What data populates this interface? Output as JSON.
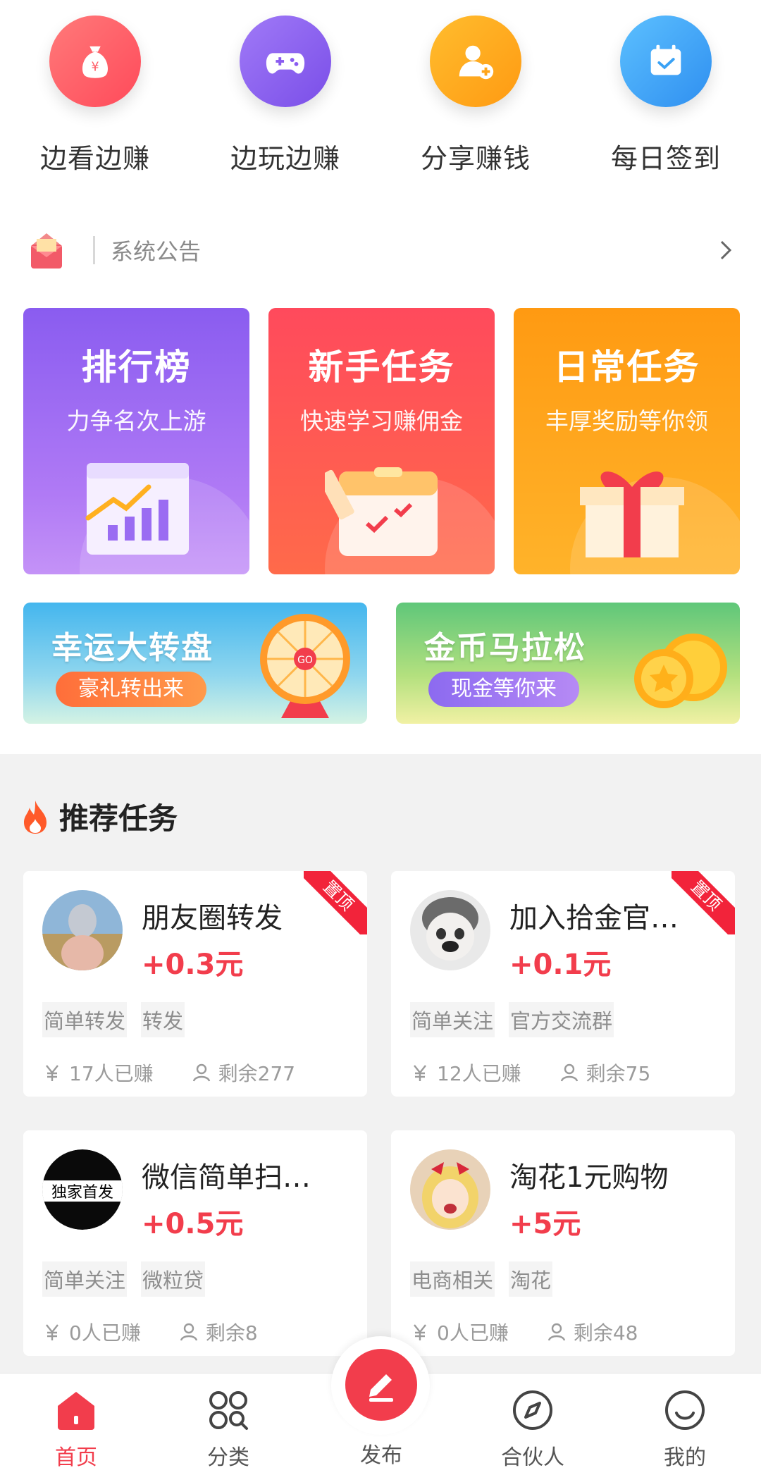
{
  "quick_entries": [
    {
      "label": "边看边赚",
      "icon": "money-bag-icon",
      "color": "#ff5a64"
    },
    {
      "label": "边玩边赚",
      "icon": "gamepad-icon",
      "color": "#8a5cf0"
    },
    {
      "label": "分享赚钱",
      "icon": "add-user-icon",
      "color": "#ffa51a"
    },
    {
      "label": "每日签到",
      "icon": "calendar-check-icon",
      "color": "#3aa2f5"
    }
  ],
  "notice": {
    "text": "系统公告"
  },
  "feature_cards": [
    {
      "title": "排行榜",
      "subtitle": "力争名次上游"
    },
    {
      "title": "新手任务",
      "subtitle": "快速学习赚佣金"
    },
    {
      "title": "日常任务",
      "subtitle": "丰厚奖励等你领"
    }
  ],
  "banners": [
    {
      "title": "幸运大转盘",
      "button": "豪礼转出来"
    },
    {
      "title": "金币马拉松",
      "button": "现金等你来"
    }
  ],
  "recommend": {
    "title": "推荐任务"
  },
  "tasks": [
    {
      "title": "朋友圈转发",
      "price": "+0.3元",
      "pinned": "置顶",
      "tags": [
        "简单转发",
        "转发"
      ],
      "earned": "17人已赚",
      "remaining": "剩余277"
    },
    {
      "title": "加入拾金官…",
      "price": "+0.1元",
      "pinned": "置顶",
      "tags": [
        "简单关注",
        "官方交流群"
      ],
      "earned": "12人已赚",
      "remaining": "剩余75"
    },
    {
      "title": "微信简单扫…",
      "price": "+0.5元",
      "avatar_text": "独家首发",
      "tags": [
        "简单关注",
        "微粒贷"
      ],
      "earned": "0人已赚",
      "remaining": "剩余8"
    },
    {
      "title": "淘花1元购物",
      "price": "+5元",
      "tags": [
        "电商相关",
        "淘花"
      ],
      "earned": "0人已赚",
      "remaining": "剩余48"
    }
  ],
  "tabbar": {
    "home": "首页",
    "category": "分类",
    "publish": "发布",
    "partner": "合伙人",
    "mine": "我的"
  },
  "colors": {
    "accent": "#f23d4c"
  }
}
